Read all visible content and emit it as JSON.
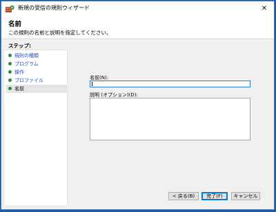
{
  "window": {
    "title": "新規の受信の規則ウィザード",
    "close_glyph": "✕"
  },
  "header": {
    "title": "名前",
    "description": "この規則の名前と説明を指定してください。"
  },
  "steps": {
    "label": "ステップ:",
    "items": [
      {
        "label": "規則の種類",
        "state": "completed"
      },
      {
        "label": "プログラム",
        "state": "completed"
      },
      {
        "label": "操作",
        "state": "completed"
      },
      {
        "label": "プロファイル",
        "state": "completed"
      },
      {
        "label": "名前",
        "state": "current"
      }
    ]
  },
  "form": {
    "name_label": "名前(N):",
    "name_value": "",
    "description_label": "説明 (オプション)(D):",
    "description_value": ""
  },
  "buttons": {
    "back": "< 戻る(B)",
    "finish": "完了(F)",
    "cancel": "キャンセル"
  },
  "colors": {
    "desktop": "#1e5aa8",
    "step_dot": "#2c8a3c",
    "step_link": "#1e4fb5",
    "focus_border": "#2b7bd6"
  }
}
